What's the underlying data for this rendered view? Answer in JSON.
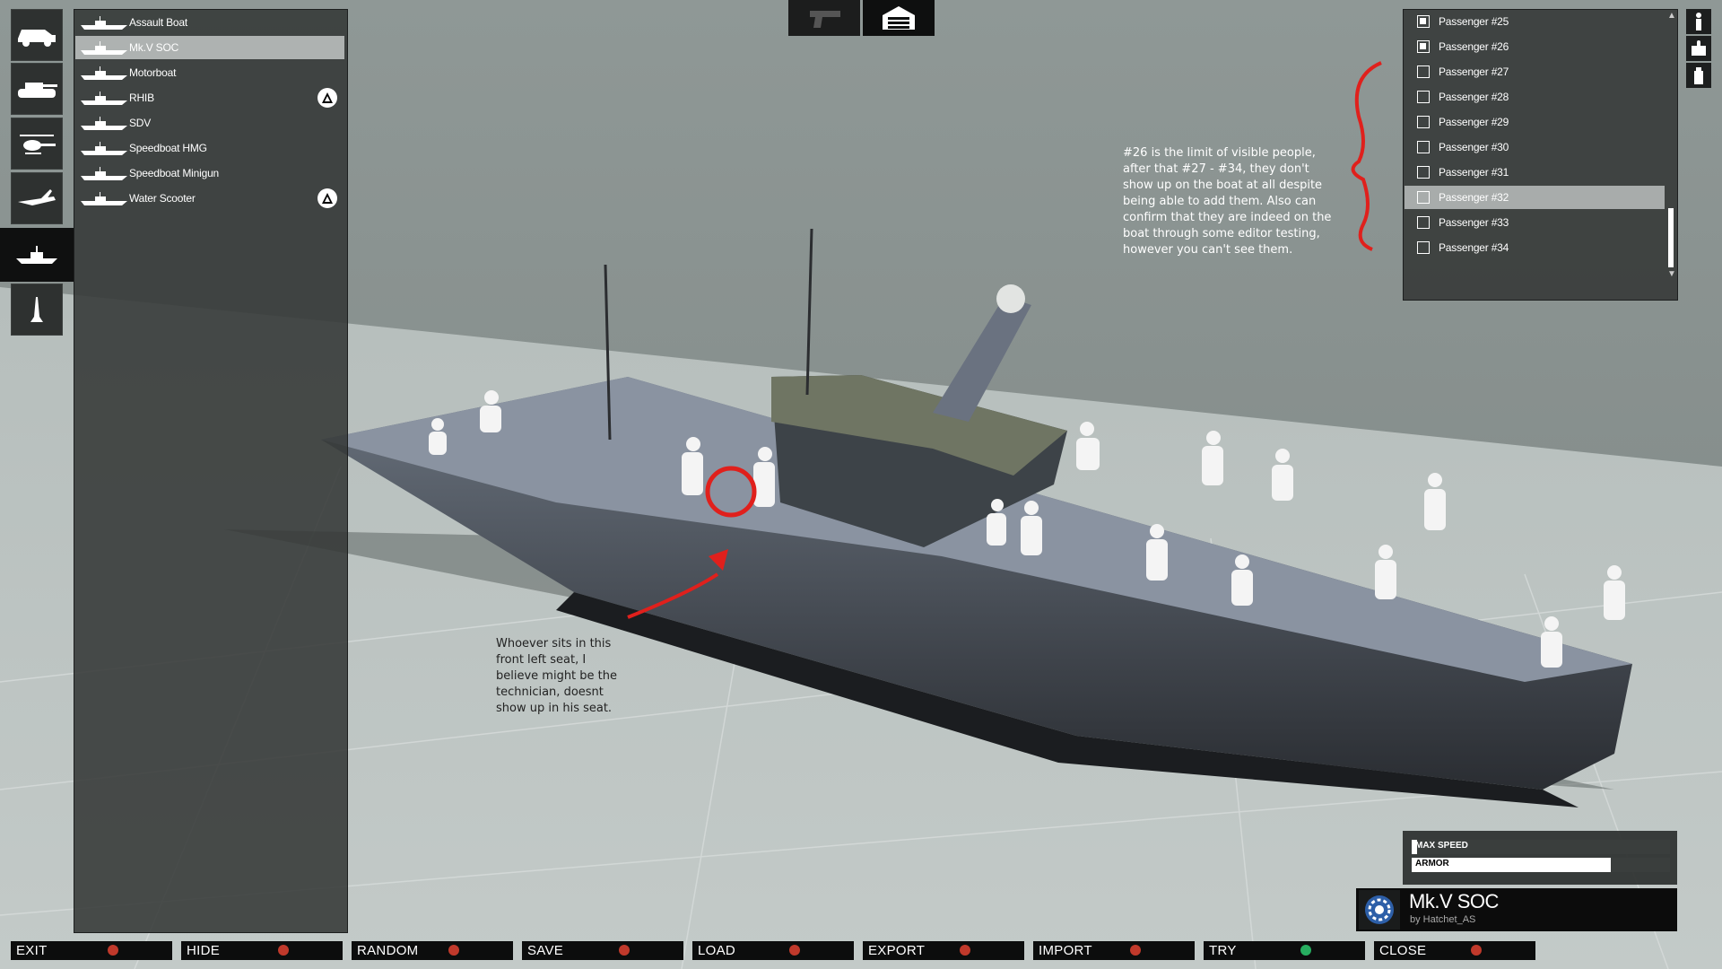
{
  "categories": [
    {
      "name": "car-icon"
    },
    {
      "name": "tank-icon"
    },
    {
      "name": "helicopter-icon"
    },
    {
      "name": "plane-icon"
    },
    {
      "name": "boat-icon"
    },
    {
      "name": "turret-icon"
    }
  ],
  "vehicles": [
    {
      "label": "Assault Boat",
      "dlc": false,
      "selected": false
    },
    {
      "label": "Mk.V SOC",
      "dlc": false,
      "selected": true
    },
    {
      "label": "Motorboat",
      "dlc": false,
      "selected": false
    },
    {
      "label": "RHIB",
      "dlc": true,
      "selected": false
    },
    {
      "label": "SDV",
      "dlc": false,
      "selected": false
    },
    {
      "label": "Speedboat HMG",
      "dlc": false,
      "selected": false
    },
    {
      "label": "Speedboat Minigun",
      "dlc": false,
      "selected": false
    },
    {
      "label": "Water Scooter",
      "dlc": true,
      "selected": false
    }
  ],
  "top_tabs": [
    {
      "name": "weapon-tab",
      "icon": "pistol-icon"
    },
    {
      "name": "garage-tab",
      "icon": "garage-icon"
    }
  ],
  "passengers": [
    {
      "label": "Passenger #25",
      "checked": true
    },
    {
      "label": "Passenger #26",
      "checked": true
    },
    {
      "label": "Passenger #27",
      "checked": false
    },
    {
      "label": "Passenger #28",
      "checked": false
    },
    {
      "label": "Passenger #29",
      "checked": false
    },
    {
      "label": "Passenger #30",
      "checked": false
    },
    {
      "label": "Passenger #31",
      "checked": false
    },
    {
      "label": "Passenger #32",
      "checked": false,
      "highlight": true
    },
    {
      "label": "Passenger #33",
      "checked": false
    },
    {
      "label": "Passenger #34",
      "checked": false
    }
  ],
  "annotations": {
    "right_note": "#26 is the limit of visible people, after that #27 - #34, they don't show up on the boat at all despite being able to add them. Also can confirm that they are indeed on the boat through some editor testing, however you can't see them.",
    "left_note": "Whoever sits in this front left seat, I believe might be the technician, doesnt show up in his seat."
  },
  "stats": {
    "max_speed_label": "MAX SPEED",
    "max_speed_value": 0.02,
    "armor_label": "ARMOR",
    "armor_value": 0.77
  },
  "vehicle_info": {
    "name": "Mk.V SOC",
    "author": "by Hatchet_AS"
  },
  "bottom_bar": [
    {
      "label": "EXIT",
      "key_color": "#c0392b"
    },
    {
      "label": "HIDE",
      "key_color": "#c0392b"
    },
    {
      "label": "RANDOM",
      "key_color": "#c0392b"
    },
    {
      "label": "SAVE",
      "key_color": "#c0392b"
    },
    {
      "label": "LOAD",
      "key_color": "#c0392b"
    },
    {
      "label": "EXPORT",
      "key_color": "#c0392b"
    },
    {
      "label": "IMPORT",
      "key_color": "#c0392b"
    },
    {
      "label": "TRY",
      "key_color": "#27ae60"
    },
    {
      "label": "CLOSE",
      "key_color": "#c0392b"
    }
  ],
  "colors": {
    "annotation_red": "#e0201c"
  }
}
